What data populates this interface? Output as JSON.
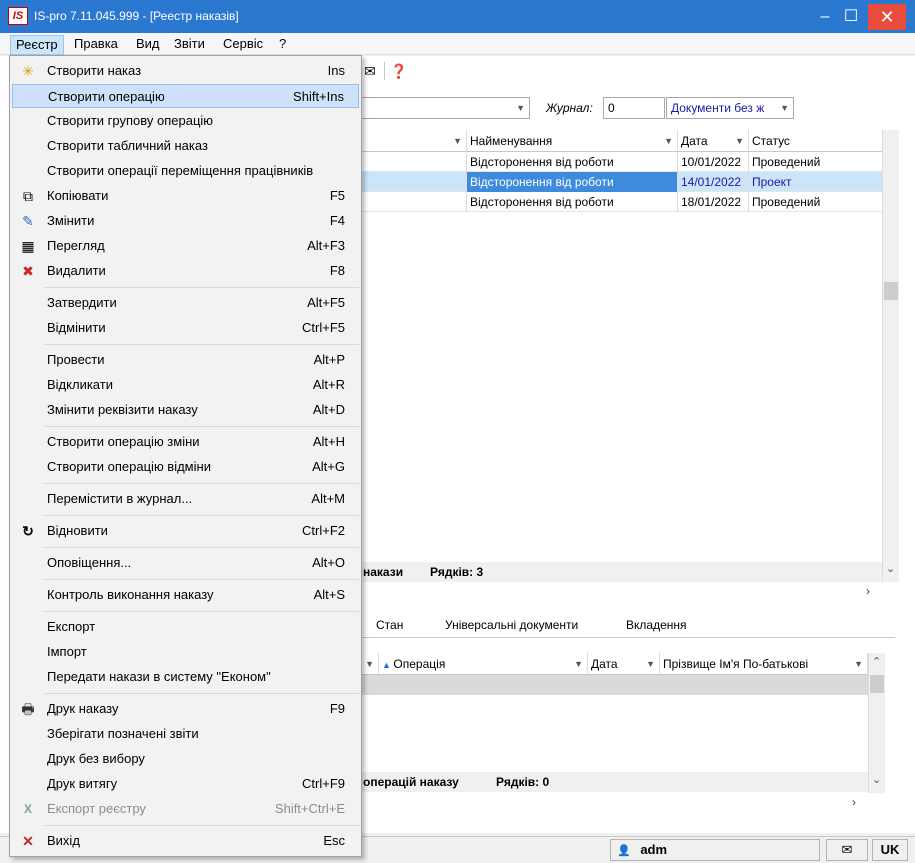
{
  "window": {
    "title": "IS-pro 7.11.045.999 - [Реестр наказів]",
    "logo": "IS",
    "min": "–",
    "max": "☐",
    "close": "✕"
  },
  "menubar": [
    "Реєстр",
    "Правка",
    "Вид",
    "Звіти",
    "Сервіс",
    "?"
  ],
  "toolbar": {
    "mail_icon": "✉",
    "help_icon": "❓"
  },
  "filter": {
    "journal_label": "Журнал:",
    "journal_value": "0",
    "journal_type": "Документи без ж"
  },
  "grid": {
    "columns": [
      "Найменування",
      "Дата",
      "Статус"
    ],
    "rows": [
      {
        "name": "Відсторонення від роботи",
        "date": "10/01/2022",
        "status": "Проведений"
      },
      {
        "name": "Відсторонення від роботи",
        "date": "14/01/2022",
        "status": "Проект"
      },
      {
        "name": "Відсторонення від роботи",
        "date": "18/01/2022",
        "status": "Проведений"
      }
    ],
    "footer_suffix": "накази",
    "footer_rows": "Рядків: 3"
  },
  "tabs": [
    "Стан",
    "Універсальні документи",
    "Вкладення"
  ],
  "subgrid": {
    "columns": [
      "Операція",
      "Дата",
      "Прізвище Ім'я По-батькові"
    ],
    "footer_suffix": "операцій наказу",
    "footer_rows": "Рядків: 0"
  },
  "statusbar": {
    "user": "adm",
    "lang": "UK",
    "mail": "✉",
    "user_icon": "👤"
  },
  "dropdown": {
    "items": [
      {
        "label": "Створити наказ",
        "shortcut": "Ins",
        "icon": "✳"
      },
      {
        "label": "Створити операцію",
        "shortcut": "Shift+Ins",
        "icon": ""
      },
      {
        "label": "Створити групову операцію",
        "shortcut": "",
        "icon": ""
      },
      {
        "label": "Створити табличний наказ",
        "shortcut": "",
        "icon": ""
      },
      {
        "label": "Створити операції переміщення працівників",
        "shortcut": "",
        "icon": ""
      },
      {
        "label": "Копіювати",
        "shortcut": "F5",
        "icon": "⧉"
      },
      {
        "label": "Змінити",
        "shortcut": "F4",
        "icon": "✎"
      },
      {
        "label": "Перегляд",
        "shortcut": "Alt+F3",
        "icon": "▦"
      },
      {
        "label": "Видалити",
        "shortcut": "F8",
        "icon": "✖"
      },
      {
        "label": "Затвердити",
        "shortcut": "Alt+F5",
        "icon": ""
      },
      {
        "label": "Відмінити",
        "shortcut": "Ctrl+F5",
        "icon": ""
      },
      {
        "label": "Провести",
        "shortcut": "Alt+P",
        "icon": ""
      },
      {
        "label": "Відкликати",
        "shortcut": "Alt+R",
        "icon": ""
      },
      {
        "label": "Змінити реквізити наказу",
        "shortcut": "Alt+D",
        "icon": ""
      },
      {
        "label": "Створити операцію зміни",
        "shortcut": "Alt+H",
        "icon": ""
      },
      {
        "label": "Створити операцію відміни",
        "shortcut": "Alt+G",
        "icon": ""
      },
      {
        "label": "Перемістити в журнал...",
        "shortcut": "Alt+M",
        "icon": ""
      },
      {
        "label": "Відновити",
        "shortcut": "Ctrl+F2",
        "icon": "↻"
      },
      {
        "label": "Оповіщення...",
        "shortcut": "Alt+O",
        "icon": ""
      },
      {
        "label": "Контроль виконання наказу",
        "shortcut": "Alt+S",
        "icon": ""
      },
      {
        "label": "Експорт",
        "shortcut": "",
        "icon": ""
      },
      {
        "label": "Імпорт",
        "shortcut": "",
        "icon": ""
      },
      {
        "label": "Передати накази в систему \"Економ\"",
        "shortcut": "",
        "icon": ""
      },
      {
        "label": "Друк наказу",
        "shortcut": "F9",
        "icon": "🖶"
      },
      {
        "label": "Зберігати позначені звіти",
        "shortcut": "",
        "icon": ""
      },
      {
        "label": "Друк без вибору",
        "shortcut": "",
        "icon": ""
      },
      {
        "label": "Друк витягу",
        "shortcut": "Ctrl+F9",
        "icon": ""
      },
      {
        "label": "Експорт реєстру",
        "shortcut": "Shift+Ctrl+E",
        "icon": "X"
      },
      {
        "label": "Вихід",
        "shortcut": "Esc",
        "icon": "✕"
      }
    ]
  }
}
